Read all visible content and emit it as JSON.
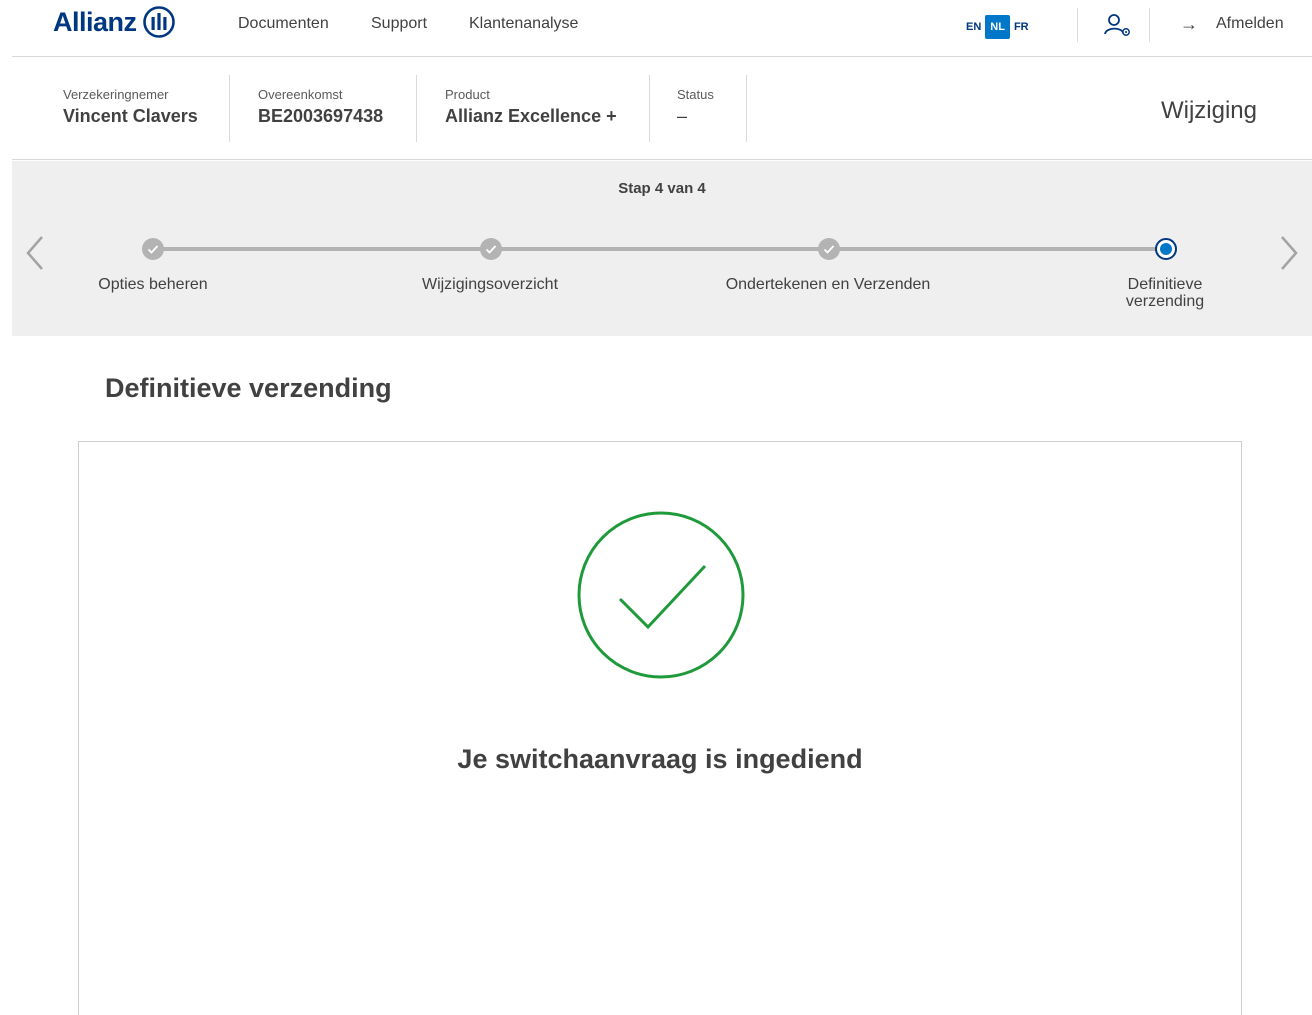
{
  "brand": {
    "name": "Allianz",
    "primary_color": "#003781",
    "accent_color": "#0077c8",
    "success_color": "#1f9a3a"
  },
  "nav": {
    "links": [
      {
        "label": "Documenten"
      },
      {
        "label": "Support"
      },
      {
        "label": "Klantenanalyse"
      }
    ],
    "languages": [
      {
        "code": "EN",
        "active": false
      },
      {
        "code": "NL",
        "active": true
      },
      {
        "code": "FR",
        "active": false
      }
    ],
    "user_icon": "user-settings-icon",
    "logout_icon": "arrow-right-icon",
    "logout_label": "Afmelden"
  },
  "contract": {
    "policyholder_label": "Verzekeringnemer",
    "policyholder_value": "Vincent Clavers",
    "agreement_label": "Overeenkomst",
    "agreement_value": "BE2003697438",
    "product_label": "Product",
    "product_value": "Allianz Excellence +",
    "status_label": "Status",
    "status_value": "–",
    "mode": "Wijziging"
  },
  "stepper": {
    "counter": "Stap 4 van 4",
    "steps": [
      {
        "label": "Opties beheren",
        "state": "done"
      },
      {
        "label": "Wijzigingsoverzicht",
        "state": "done"
      },
      {
        "label": "Ondertekenen en Verzenden",
        "state": "done"
      },
      {
        "label": "Definitieve verzending",
        "state": "current"
      }
    ],
    "prev_icon": "chevron-left-icon",
    "next_icon": "chevron-right-icon"
  },
  "main": {
    "title": "Definitieve verzending",
    "success_icon": "check-circle-icon",
    "success_message": "Je switchaanvraag is ingediend"
  }
}
